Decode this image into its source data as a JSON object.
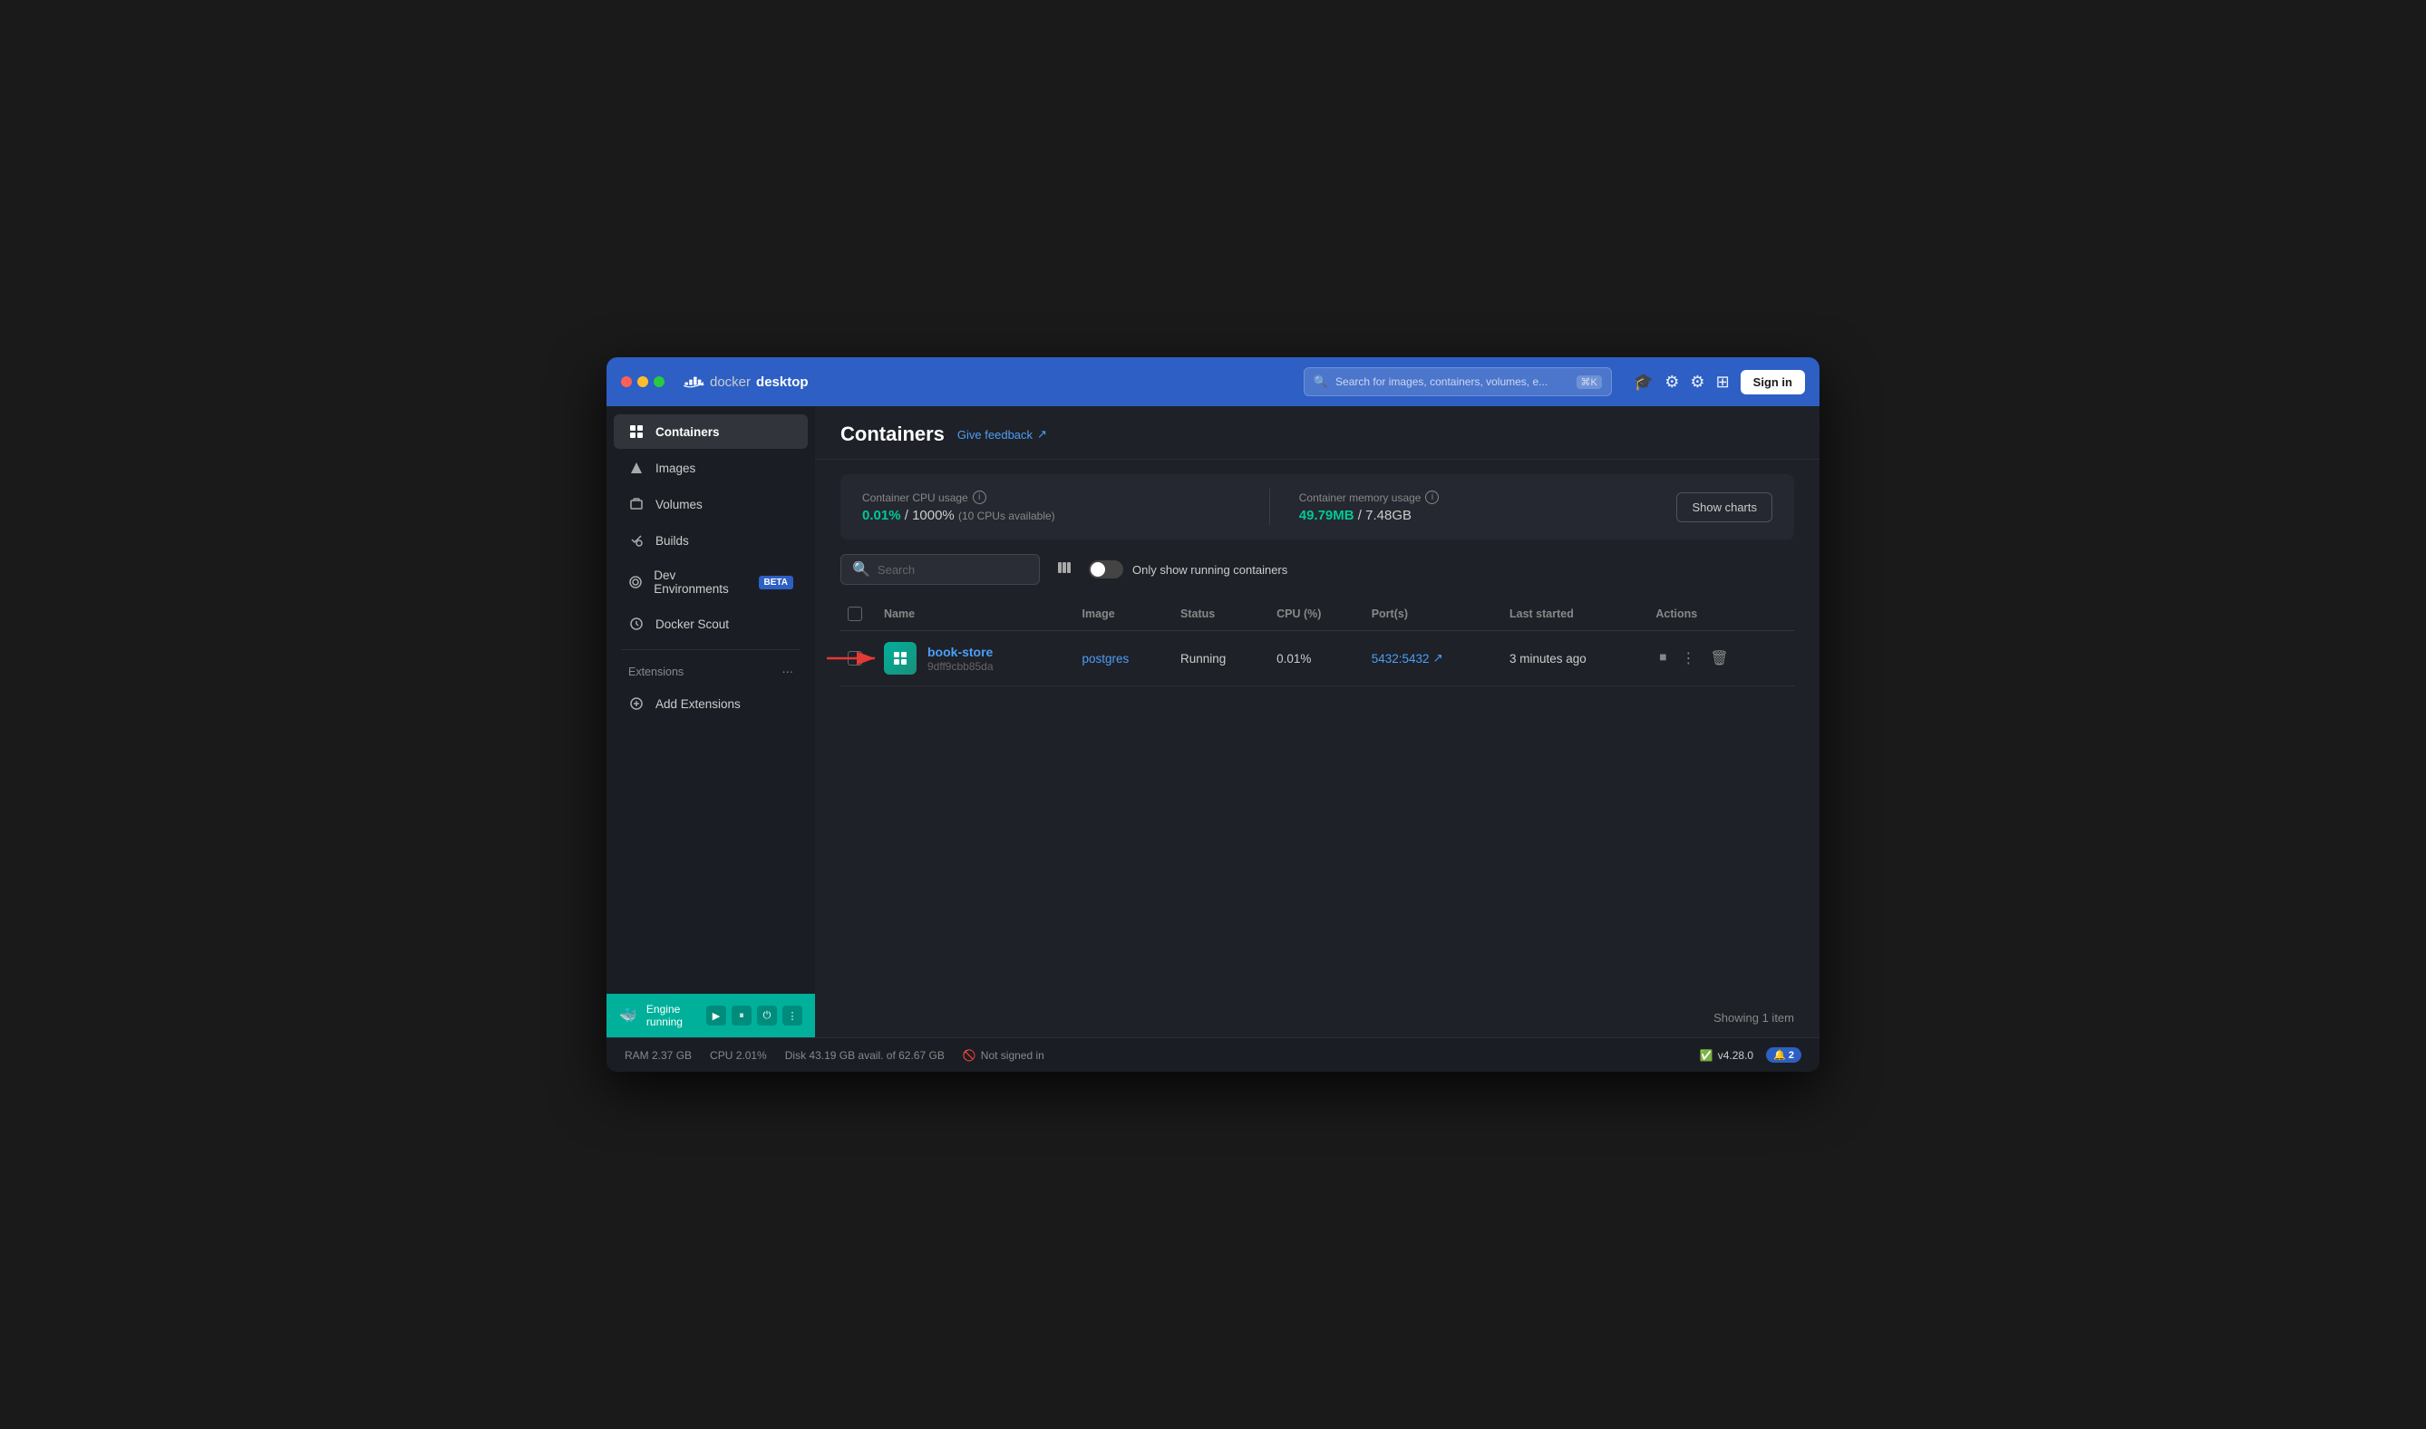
{
  "window": {
    "title": "Docker Desktop"
  },
  "titlebar": {
    "brand_docker": "docker",
    "brand_desktop": "desktop",
    "search_placeholder": "Search for images, containers, volumes, e...",
    "search_kbd": "⌘K",
    "sign_in_label": "Sign in"
  },
  "sidebar": {
    "items": [
      {
        "id": "containers",
        "label": "Containers",
        "icon": "▦",
        "active": true
      },
      {
        "id": "images",
        "label": "Images",
        "icon": "⬡",
        "active": false
      },
      {
        "id": "volumes",
        "label": "Volumes",
        "icon": "⊞",
        "active": false
      },
      {
        "id": "builds",
        "label": "Builds",
        "icon": "🔧",
        "active": false
      },
      {
        "id": "dev-environments",
        "label": "Dev Environments",
        "icon": "◈",
        "active": false,
        "badge": "BETA"
      },
      {
        "id": "docker-scout",
        "label": "Docker Scout",
        "icon": "◎",
        "active": false
      }
    ],
    "extensions_label": "Extensions",
    "add_extensions_label": "Add Extensions"
  },
  "engine": {
    "status_label": "Engine running"
  },
  "header": {
    "title": "Containers",
    "feedback_label": "Give feedback",
    "feedback_icon": "↗"
  },
  "stats": {
    "cpu_label": "Container CPU usage",
    "cpu_value": "0.01%",
    "cpu_separator": "/",
    "cpu_total": "1000%",
    "cpu_note": "(10 CPUs available)",
    "memory_label": "Container memory usage",
    "memory_value": "49.79MB",
    "memory_separator": "/",
    "memory_total": "7.48GB",
    "show_charts_label": "Show charts"
  },
  "toolbar": {
    "search_placeholder": "Search",
    "toggle_label": "Only show running containers"
  },
  "table": {
    "columns": [
      {
        "id": "checkbox",
        "label": ""
      },
      {
        "id": "name",
        "label": "Name"
      },
      {
        "id": "image",
        "label": "Image"
      },
      {
        "id": "status",
        "label": "Status"
      },
      {
        "id": "cpu",
        "label": "CPU (%)"
      },
      {
        "id": "ports",
        "label": "Port(s)"
      },
      {
        "id": "last_started",
        "label": "Last started"
      },
      {
        "id": "actions",
        "label": "Actions"
      }
    ],
    "rows": [
      {
        "id": "book-store",
        "name": "book-store",
        "container_id": "9dff9cbb85da",
        "image": "postgres",
        "status": "Running",
        "cpu": "0.01%",
        "ports": "5432:5432",
        "last_started": "3 minutes ago"
      }
    ]
  },
  "showing_label": "Showing 1 item",
  "statusbar": {
    "ram": "RAM 2.37 GB",
    "cpu": "CPU 2.01%",
    "disk": "Disk 43.19 GB avail. of 62.67 GB",
    "signin_status": "Not signed in",
    "version": "v4.28.0",
    "notifications": "2"
  }
}
